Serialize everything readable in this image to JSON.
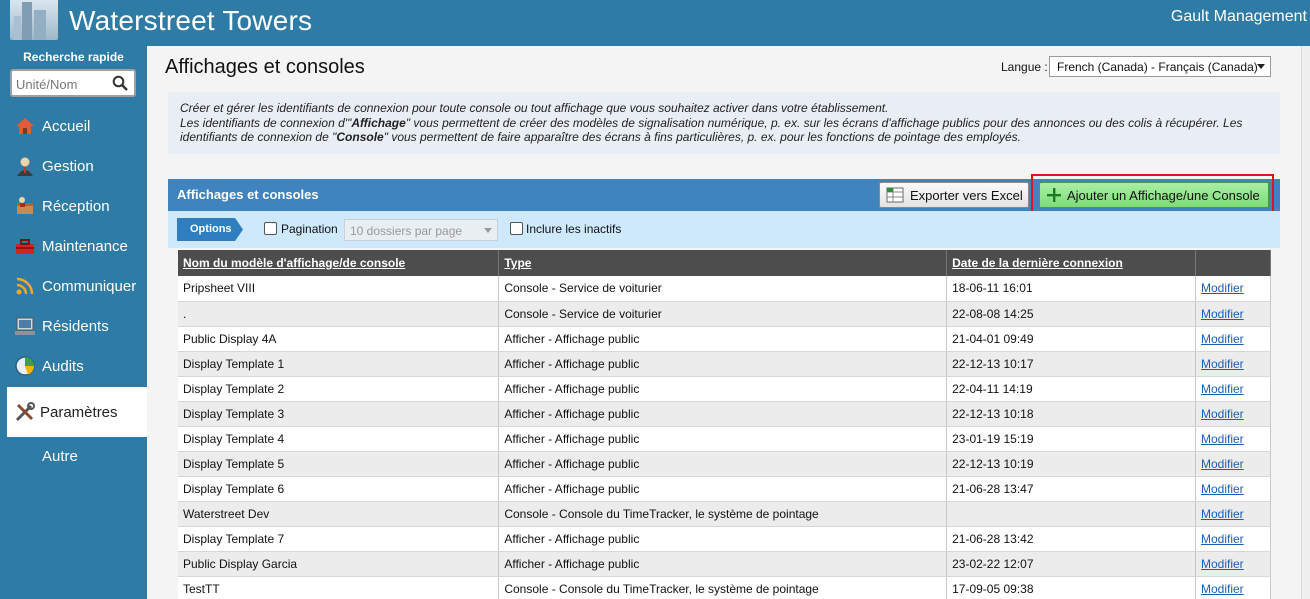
{
  "header": {
    "app_title": "Waterstreet Towers",
    "company": "Gault Management"
  },
  "sidebar": {
    "quick_search_label": "Recherche rapide",
    "quick_search_placeholder": "Unité/Nom",
    "items": [
      {
        "label": "Accueil",
        "icon": "home-icon"
      },
      {
        "label": "Gestion",
        "icon": "manager-icon"
      },
      {
        "label": "Réception",
        "icon": "package-icon"
      },
      {
        "label": "Maintenance",
        "icon": "toolbox-icon"
      },
      {
        "label": "Communiquer",
        "icon": "broadcast-icon"
      },
      {
        "label": "Résidents",
        "icon": "residents-icon"
      },
      {
        "label": "Audits",
        "icon": "pie-chart-icon"
      },
      {
        "label": "Paramètres",
        "icon": "tools-icon",
        "active": true
      },
      {
        "label": "Autre",
        "icon": ""
      }
    ]
  },
  "main": {
    "page_title": "Affichages et consoles",
    "language_label": "Langue :",
    "language_value": "French (Canada) - Français (Canada)",
    "info": {
      "line1": "Créer et gérer les identifiants de connexion pour toute console ou tout affichage que vous souhaitez activer dans votre établissement.",
      "line2_pre": "Les identifiants de connexion d'\"",
      "line2_bold": "Affichage",
      "line2_post": "\" vous permettent de créer des modèles de signalisation numérique, p. ex. sur les écrans d'affichage publics pour des annonces ou des colis à récupérer. Les",
      "line3_pre": "identifiants de connexion de \"",
      "line3_bold": "Console",
      "line3_post": "\" vous permettent de faire apparaître des écrans à fins particulières, p. ex. pour les fonctions de pointage des employés."
    },
    "panel_title": "Affichages et consoles",
    "export_label": "Exporter vers Excel",
    "add_label": "Ajouter un Affichage/une Console",
    "options_label": "Options",
    "pagination_label": "Pagination",
    "per_page_value": "10 dossiers par page",
    "inactive_label": "Inclure les inactifs",
    "columns": [
      "Nom du modèle d'affichage/de console",
      "Type",
      "Date de la dernière connexion",
      ""
    ],
    "edit_label": "Modifier",
    "rows": [
      [
        "Pripsheet VIII",
        "Console - Service de voiturier",
        "18-06-11 16:01"
      ],
      [
        ".",
        "Console - Service de voiturier",
        "22-08-08 14:25"
      ],
      [
        "Public Display 4A",
        "Afficher - Affichage public",
        "21-04-01 09:49"
      ],
      [
        "Display Template 1",
        "Afficher - Affichage public",
        "22-12-13 10:17"
      ],
      [
        "Display Template 2",
        "Afficher - Affichage public",
        "22-04-11 14:19"
      ],
      [
        "Display Template 3",
        "Afficher - Affichage public",
        "22-12-13 10:18"
      ],
      [
        "Display Template 4",
        "Afficher - Affichage public",
        "23-01-19 15:19"
      ],
      [
        "Display Template 5",
        "Afficher - Affichage public",
        "22-12-13 10:19"
      ],
      [
        "Display Template 6",
        "Afficher - Affichage public",
        "21-06-28 13:47"
      ],
      [
        "Waterstreet Dev",
        "Console - Console du TimeTracker, le système de pointage",
        ""
      ],
      [
        "Display Template 7",
        "Afficher - Affichage public",
        "21-06-28 13:42"
      ],
      [
        "Public Display Garcia",
        "Afficher - Affichage public",
        "23-02-22 12:07"
      ],
      [
        "TestTT",
        "Console - Console du TimeTracker, le système de pointage",
        "17-09-05 09:38"
      ]
    ]
  }
}
